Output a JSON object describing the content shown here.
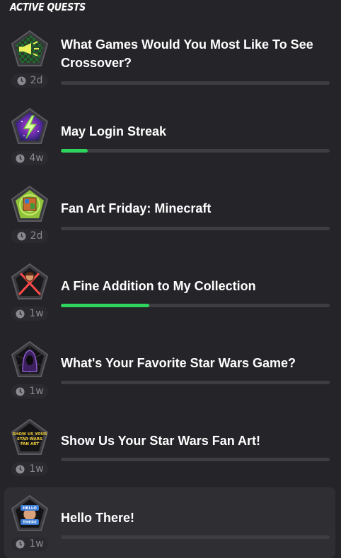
{
  "header": {
    "title": "ACTIVE QUESTS"
  },
  "quests": [
    {
      "title": "What Games Would You Most Like To See Crossover?",
      "time": "2d",
      "progress": 0.0,
      "icon": "megaphone-icon"
    },
    {
      "title": "May Login Streak",
      "time": "4w",
      "progress": 0.1,
      "icon": "lightning-icon"
    },
    {
      "title": "Fan Art Friday: Minecraft",
      "time": "2d",
      "progress": 0.0,
      "icon": "minecraft-art-icon"
    },
    {
      "title": "A Fine Addition to My Collection",
      "time": "1w",
      "progress": 0.33,
      "icon": "lightsaber-icon"
    },
    {
      "title": "What's Your Favorite Star Wars Game?",
      "time": "1w",
      "progress": 0.0,
      "icon": "hooded-figure-icon"
    },
    {
      "title": "Show Us Your Star Wars Fan Art!",
      "time": "1w",
      "progress": 0.0,
      "icon": "star-wars-fan-art-icon",
      "badge_text": "SHOW US YOUR STAR WARS FAN ART"
    },
    {
      "title": "Hello There!",
      "time": "1w",
      "progress": 0.0,
      "icon": "hello-there-icon",
      "badge_text": "HELLO THERE"
    }
  ],
  "colors": {
    "progress": "#2fd45c",
    "track": "#3e3d42",
    "background": "#252428"
  }
}
